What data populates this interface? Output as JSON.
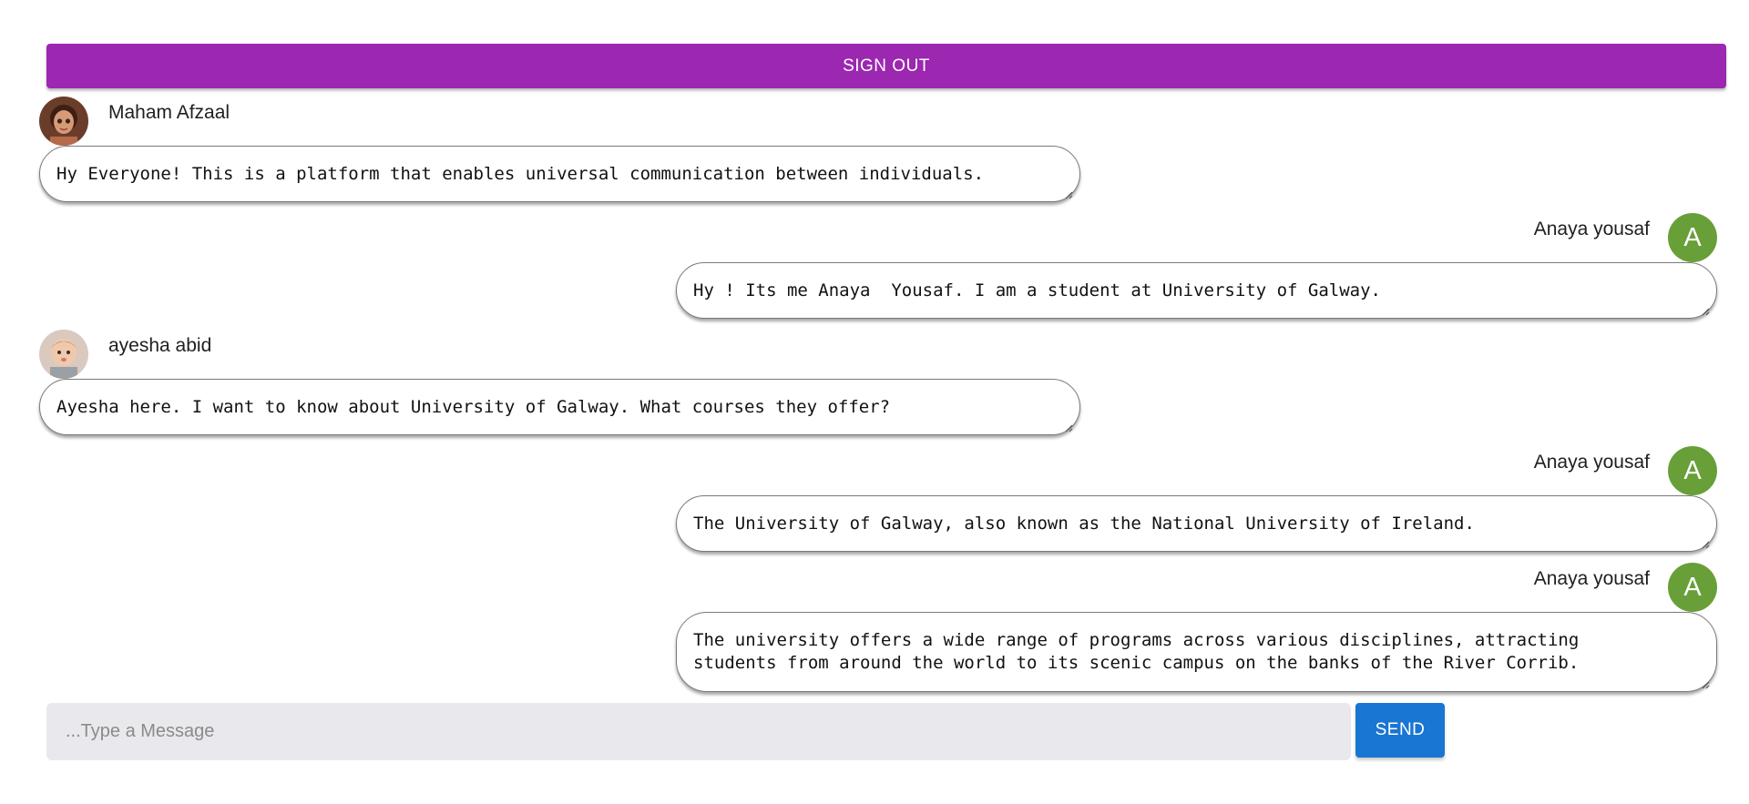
{
  "header": {
    "signout_label": "SIGN OUT"
  },
  "messages": [
    {
      "sender": "Maham Afzaal",
      "avatar": "photo-woman-avatar",
      "text": "Hy Everyone! This is a platform that enables universal communication between individuals."
    },
    {
      "sender": "Anaya yousaf",
      "avatar_letter": "A",
      "text": "Hy ! Its me Anaya  Yousaf. I am a student at University of Galway."
    },
    {
      "sender": "ayesha abid",
      "avatar": "photo-baby-avatar",
      "text": "Ayesha here. I want to know about University of Galway. What courses they offer?"
    },
    {
      "sender": "Anaya yousaf",
      "avatar_letter": "A",
      "text": "The University of Galway, also known as the National University of Ireland."
    },
    {
      "sender": "Anaya yousaf",
      "avatar_letter": "A",
      "text": "The university offers a wide range of programs across various disciplines, attracting\nstudents from around the world to its scenic campus on the banks of the River Corrib."
    }
  ],
  "composer": {
    "placeholder": "...Type a Message",
    "send_label": "SEND"
  },
  "colors": {
    "signout": "#9c27b0",
    "send": "#1976d2",
    "avatar_letter_bg": "#689f38",
    "input_bg": "#e9e9ed"
  }
}
